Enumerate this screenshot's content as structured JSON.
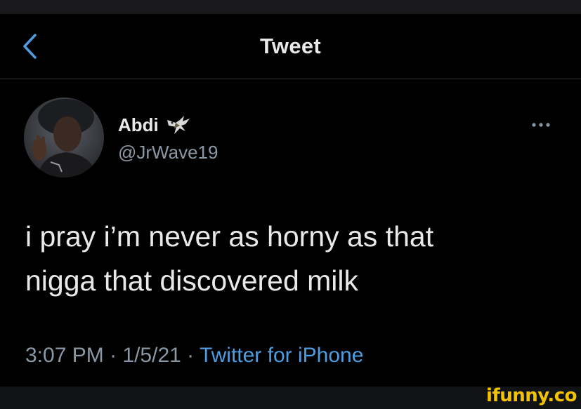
{
  "navbar": {
    "back_icon": "chevron-left-icon",
    "title": "Tweet"
  },
  "author": {
    "display_name": "Abdi",
    "name_emoji_icon": "eagle-emoji-icon",
    "handle": "@JrWave19"
  },
  "more_icon": "more-horizontal-icon",
  "tweet": {
    "lines": [
      "i pray i’m never as horny as that",
      "nigga that discovered milk"
    ]
  },
  "meta": {
    "time": "3:07 PM",
    "separator": " · ",
    "date": "1/5/21",
    "source": "Twitter for iPhone"
  },
  "watermark": "ifunny.co",
  "colors": {
    "background": "#000000",
    "text_primary": "#e7e9ea",
    "text_secondary": "#8b98a5",
    "link_blue": "#4d9de0",
    "watermark_yellow": "#f2c400"
  }
}
